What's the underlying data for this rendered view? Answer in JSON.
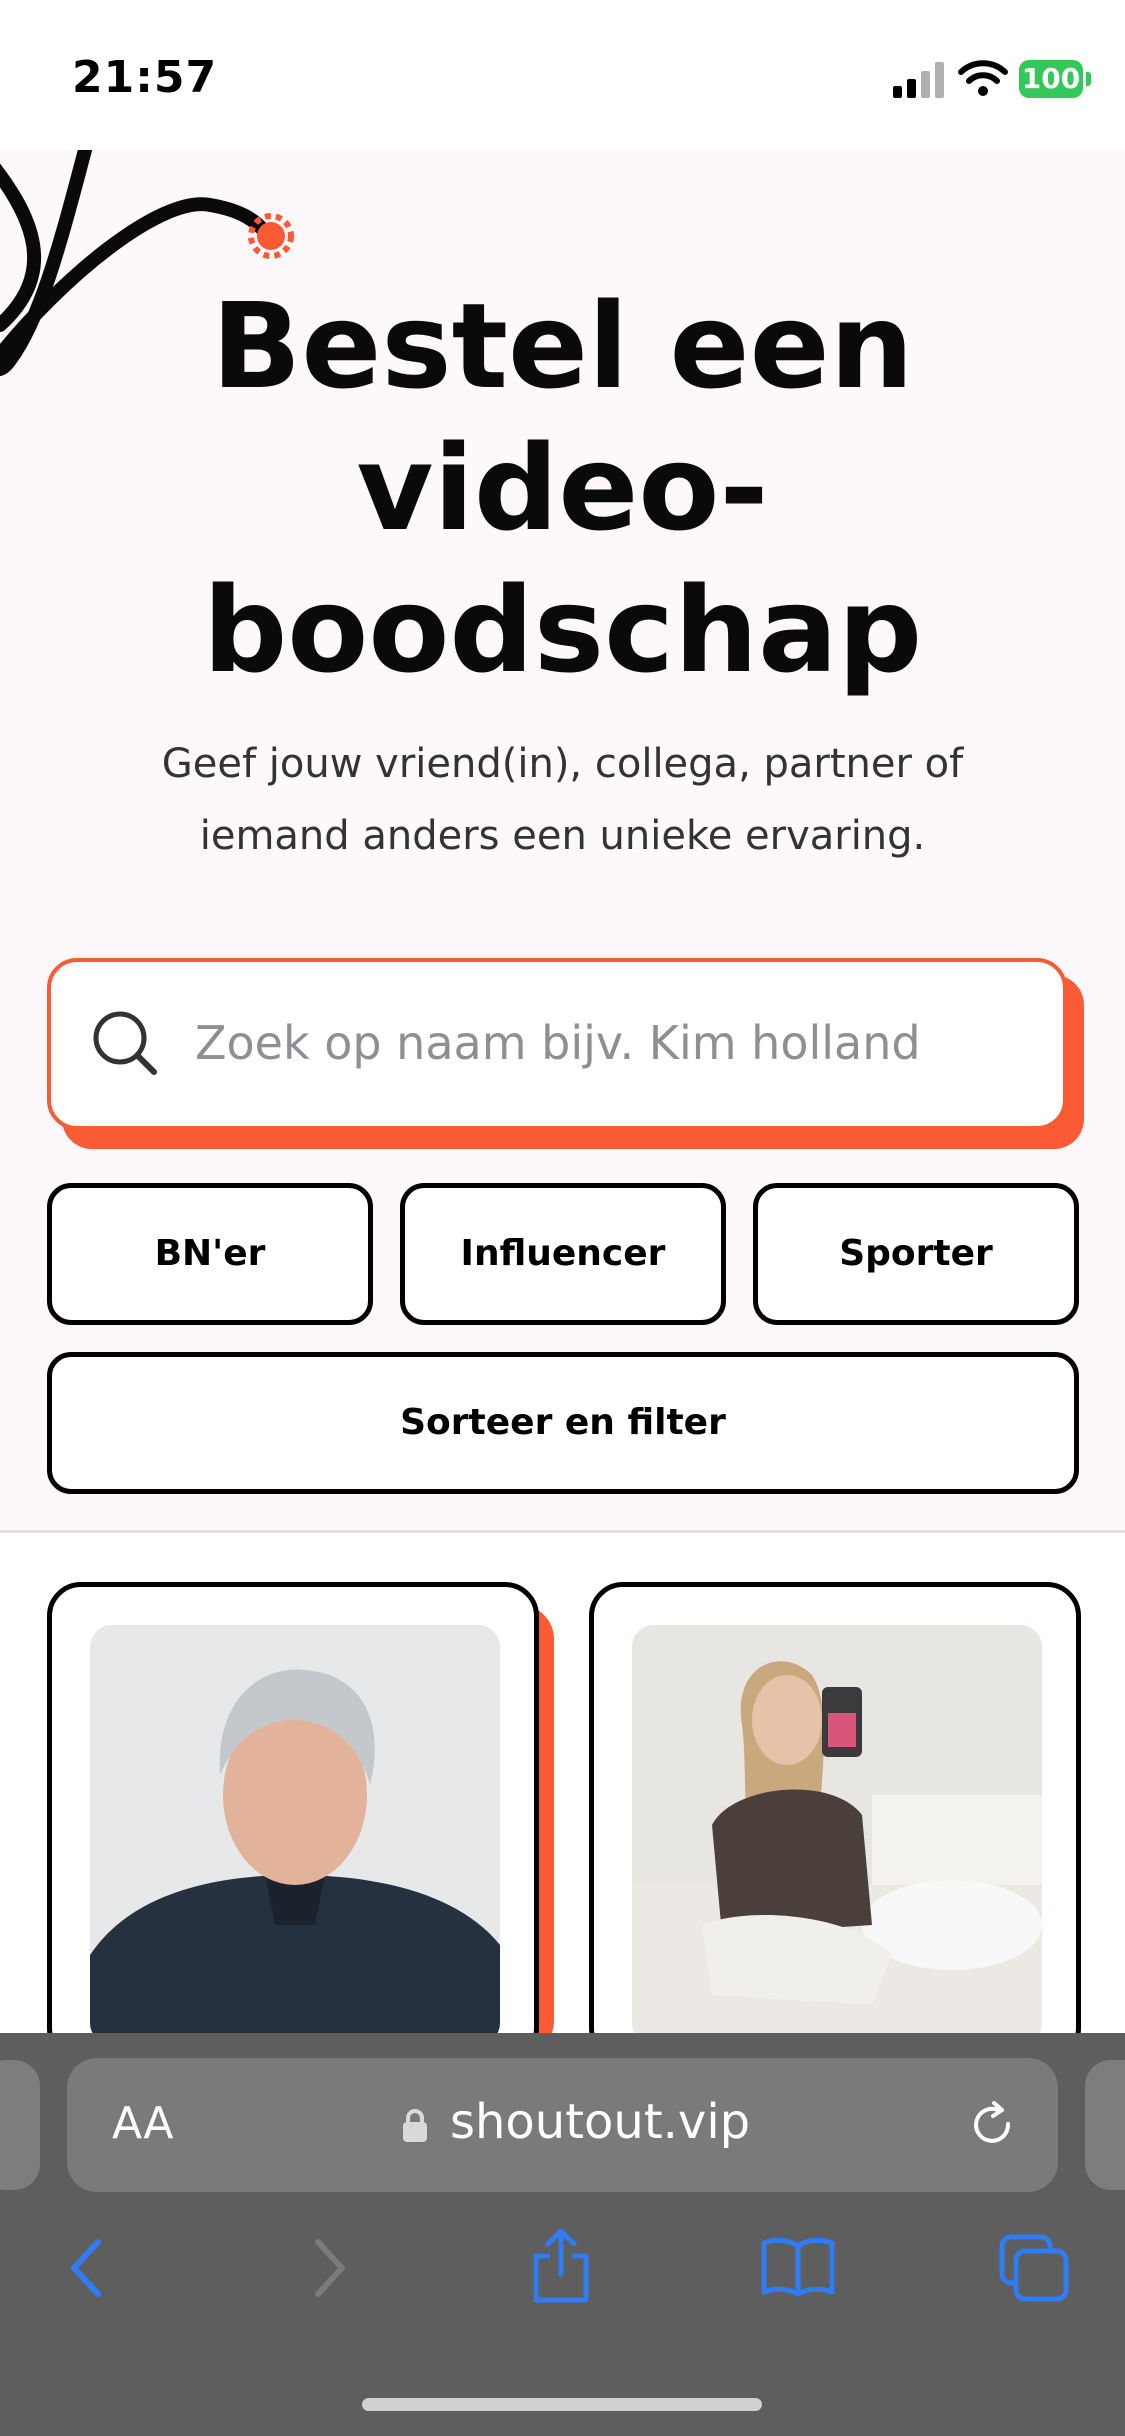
{
  "status_bar": {
    "time": "21:57",
    "battery": "100",
    "icons": [
      "signal-icon",
      "wifi-icon",
      "battery-icon"
    ]
  },
  "hero": {
    "title_lines": [
      "Bestel een",
      "video-",
      "boodschap"
    ],
    "subtitle_lines": [
      "Geef jouw vriend(in), collega, partner of",
      "iemand anders een unieke ervaring."
    ]
  },
  "search": {
    "placeholder": "Zoek op naam bijv. Kim holland"
  },
  "filters": {
    "chips": [
      "BN'er",
      "Influencer",
      "Sporter"
    ],
    "sort_label": "Sorteer en filter"
  },
  "browser": {
    "text_size_label": "AA",
    "url": "shoutout.vip",
    "toolbar_icons": [
      "back-icon",
      "forward-icon",
      "share-icon",
      "bookmarks-icon",
      "tabs-icon"
    ]
  },
  "colors": {
    "accent": "#fa5a34",
    "hero_bg": "#fcf8fc",
    "safari_blue": "#2f7cf6"
  }
}
